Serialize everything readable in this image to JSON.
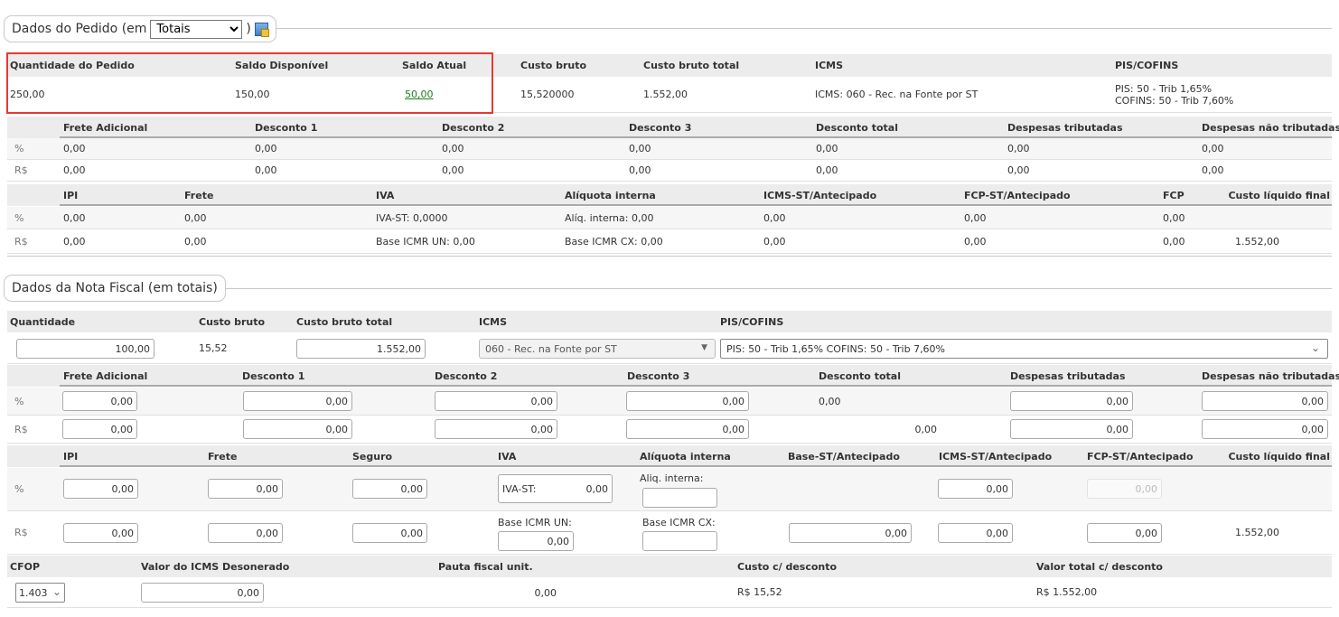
{
  "pedido": {
    "legend_prefix": "Dados do Pedido (em",
    "legend_select": "Totais",
    "legend_suffix": ")",
    "summary_headers": [
      "Quantidade do Pedido",
      "Saldo Disponível",
      "Saldo Atual",
      "Custo bruto",
      "Custo bruto total",
      "ICMS",
      "PIS/COFINS"
    ],
    "summary_values": {
      "quantidade": "250,00",
      "saldo_disponivel": "150,00",
      "saldo_atual": "50,00",
      "custo_bruto": "15,520000",
      "custo_bruto_total": "1.552,00",
      "icms": "ICMS: 060 - Rec. na Fonte por ST",
      "pis": "PIS: 50 - Trib 1,65%",
      "cofins": "COFINS: 50 - Trib 7,60%"
    },
    "desc_headers": [
      "Frete Adicional",
      "Desconto 1",
      "Desconto 2",
      "Desconto 3",
      "Desconto total",
      "Despesas tributadas",
      "Despesas não tributadas"
    ],
    "desc_pct": [
      "0,00",
      "0,00",
      "0,00",
      "0,00",
      "0,00",
      "0,00",
      "0,00"
    ],
    "desc_rs": [
      "0,00",
      "0,00",
      "0,00",
      "0,00",
      "0,00",
      "0,00",
      "0,00"
    ],
    "tax_headers": [
      "IPI",
      "Frete",
      "IVA",
      "Alíquota interna",
      "ICMS-ST/Antecipado",
      "FCP-ST/Antecipado",
      "FCP",
      "Custo líquido final"
    ],
    "tax_pct": [
      "0,00",
      "0,00",
      "IVA-ST: 0,0000",
      "Alíq. interna: 0,00",
      "0,00",
      "0,00",
      "0,00",
      ""
    ],
    "tax_rs": [
      "0,00",
      "0,00",
      "Base ICMR UN: 0,00",
      "Base ICMR CX: 0,00",
      "0,00",
      "0,00",
      "0,00",
      "1.552,00"
    ],
    "row_labels": {
      "pct": "%",
      "rs": "R$"
    }
  },
  "nota": {
    "legend": "Dados da Nota Fiscal (em totais)",
    "top_headers": [
      "Quantidade",
      "Custo bruto",
      "Custo bruto total",
      "ICMS",
      "PIS/COFINS"
    ],
    "quantidade": "100,00",
    "custo_bruto": "15,52",
    "custo_bruto_total": "1.552,00",
    "icms_select": "060 - Rec. na Fonte por ST",
    "pis_cofins_select": "PIS: 50 - Trib 1,65% COFINS: 50 - Trib 7,60%",
    "desc_headers": [
      "Frete Adicional",
      "Desconto 1",
      "Desconto 2",
      "Desconto 3",
      "Desconto total",
      "Despesas tributadas",
      "Despesas não tributadas"
    ],
    "desc_pct": [
      "0,00",
      "0,00",
      "0,00",
      "0,00",
      "0,00",
      "0,00",
      "0,00"
    ],
    "desc_rs": [
      "0,00",
      "0,00",
      "0,00",
      "0,00",
      "0,00",
      "0,00",
      "0,00"
    ],
    "tax_headers": [
      "IPI",
      "Frete",
      "Seguro",
      "IVA",
      "Alíquota interna",
      "Base-ST/Antecipado",
      "ICMS-ST/Antecipado",
      "FCP-ST/Antecipado",
      "Custo líquido final"
    ],
    "tax_pct": {
      "ipi": "0,00",
      "frete": "0,00",
      "seguro": "0,00",
      "iva_label": "IVA-ST:",
      "iva": "0,00",
      "aliq_label": "Aliq. interna:",
      "aliq": "",
      "icms_st": "0,00",
      "fcp_st": "0,00"
    },
    "tax_rs": {
      "ipi": "0,00",
      "frete": "0,00",
      "seguro": "0,00",
      "base_un_label": "Base ICMR UN:",
      "base_un": "0,00",
      "base_cx_label": "Base ICMR CX:",
      "base_cx": "",
      "base_st": "0,00",
      "icms_st": "0,00",
      "fcp_st": "0,00",
      "custo_liq": "1.552,00"
    },
    "bottom_headers": [
      "CFOP",
      "Valor do ICMS Desonerado",
      "Pauta fiscal unit.",
      "Custo c/ desconto",
      "Valor total c/ desconto"
    ],
    "cfop": "1.403",
    "icms_desonerado": "0,00",
    "pauta": "0,00",
    "custo_desc": "R$ 15,52",
    "valor_total_desc": "R$ 1.552,00",
    "row_labels": {
      "pct": "%",
      "rs": "R$"
    }
  }
}
